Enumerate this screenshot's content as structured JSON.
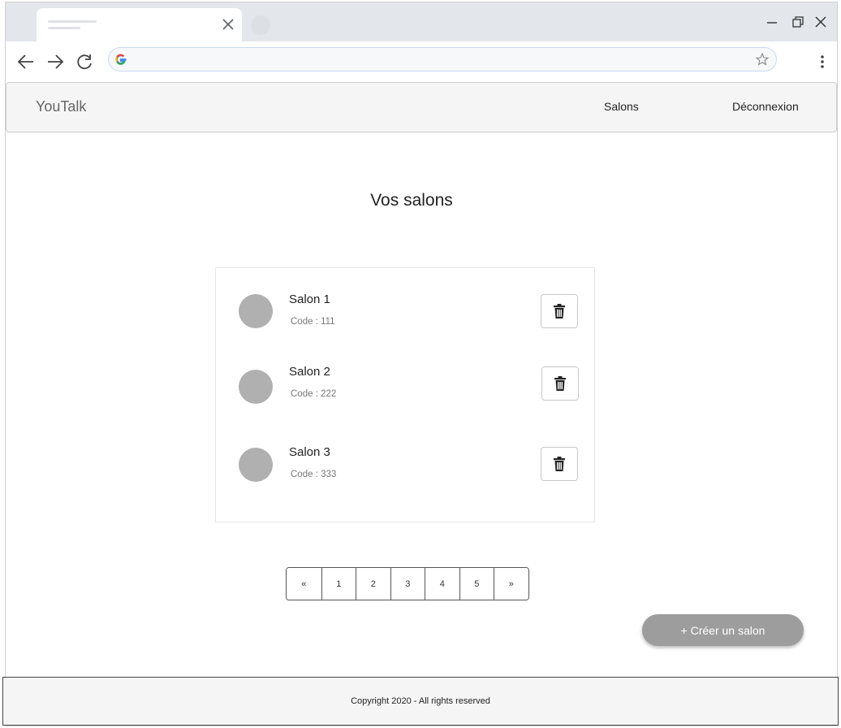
{
  "browser": {
    "address_value": "",
    "icons": [
      "close-icon",
      "new-tab-icon",
      "minimize-icon",
      "restore-icon",
      "back-icon",
      "forward-icon",
      "reload-icon",
      "google-icon",
      "star-icon",
      "menu-icon"
    ]
  },
  "navbar": {
    "brand": "YouTalk",
    "links": [
      "Salons",
      "Déconnexion"
    ]
  },
  "main": {
    "title": "Vos salons",
    "salons": [
      {
        "name": "Salon 1",
        "code": "Code : 111"
      },
      {
        "name": "Salon 2",
        "code": "Code : 222"
      },
      {
        "name": "Salon 3",
        "code": "Code : 333"
      }
    ],
    "pagination": [
      "«",
      "1",
      "2",
      "3",
      "4",
      "5",
      "»"
    ],
    "create_button": "+ Créer un salon"
  },
  "footer": {
    "text": "Copyright 2020 - All rights reserved"
  },
  "colors": {
    "avatar": "#b0b0b0",
    "create_button_bg": "#9d9d9d",
    "navbar_bg": "#f5f5f5"
  }
}
